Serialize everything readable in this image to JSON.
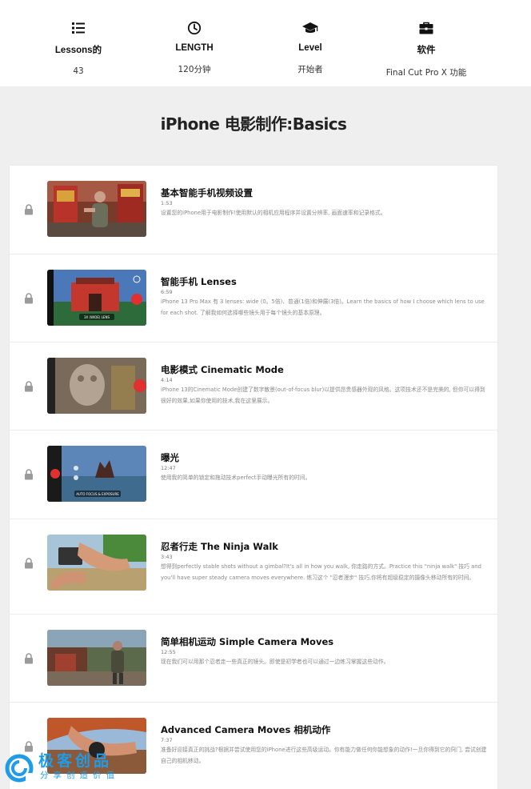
{
  "stats": [
    {
      "label": "Lessons的",
      "value": "43",
      "icon": "list-icon"
    },
    {
      "label": "LENGTH",
      "value": "120分钟",
      "icon": "clock-icon"
    },
    {
      "label": "Level",
      "value": "开始者",
      "icon": "graduation-cap-icon"
    },
    {
      "label": "软件",
      "value": "Final Cut Pro X 功能",
      "icon": "toolbox-icon"
    }
  ],
  "course": {
    "title": "iPhone 电影制作:Basics"
  },
  "lessons": [
    {
      "title": "基本智能手机视频设置",
      "duration": "1:53",
      "description": "设置您的iPhone用于电影制作!使用默认的相机应用程序并设置分辨率, 画面速率和记录格式。",
      "thumb_label": ""
    },
    {
      "title": "智能手机 Lenses",
      "duration": "6:59",
      "description": "iPhone 13 Pro Max 有 3 lenses: wide (0。5倍)、普通(1倍)和伸展(3倍)。Learn the basics of how I choose which lens to use for each shot. 了解我如何选择哪些镜头用于每个镜头的基本原理。",
      "thumb_label": "3X (WIDE) LENS"
    },
    {
      "title": "电影模式 Cinematic Mode",
      "duration": "4:14",
      "description": "iPhone 13的Cinematic Mode创建了数字散景(out-of-focus blur)以提供昂贵感器外观的风格。这项技术还不是完美的, 但你可以得到很好的效果,如果你使用的技术,我在这里展示。",
      "thumb_label": ""
    },
    {
      "title": "曝光",
      "duration": "12:47",
      "description": "使用我的简单的锁定和拖动技术perfect手动曝光所有的时间。",
      "thumb_label": "AUTO FOCUS & EXPOSURE"
    },
    {
      "title": "忍者行走 The Ninja Walk",
      "duration": "3:43",
      "description": "想得到perfectly stable shots without a gimbal?It's all in how you walk, 你走路的方式。Practice this \"ninja walk\" 技巧 and you'll have super steady camera moves everywhere. 练习这个 \"忍者漫步\" 技巧,你将有超级稳定的摄像头移动所有的时间。",
      "thumb_label": ""
    },
    {
      "title": "简单相机运动 Simple Camera Moves",
      "duration": "12:55",
      "description": "现在我们可以用那个忍者走一些真正的镜头。即使是初学者也可以通过一边练习掌握这些动作。",
      "thumb_label": ""
    },
    {
      "title": "Advanced Camera Moves 相机动作",
      "duration": "7:37",
      "description": "准备好迎接真正的挑战?根据并尝试使用您的iPhone进行这些高级运动。你有能力做任何你能想象的动作!一旦你得到它的窍门, 尝试创建自己的相机移动。",
      "thumb_label": ""
    }
  ],
  "watermark": {
    "text": "极客创品",
    "subtext": "分享创造价值"
  },
  "colors": {
    "accent": "#1e9be9",
    "lock": "#9a9a9a",
    "background": "#efefef"
  }
}
